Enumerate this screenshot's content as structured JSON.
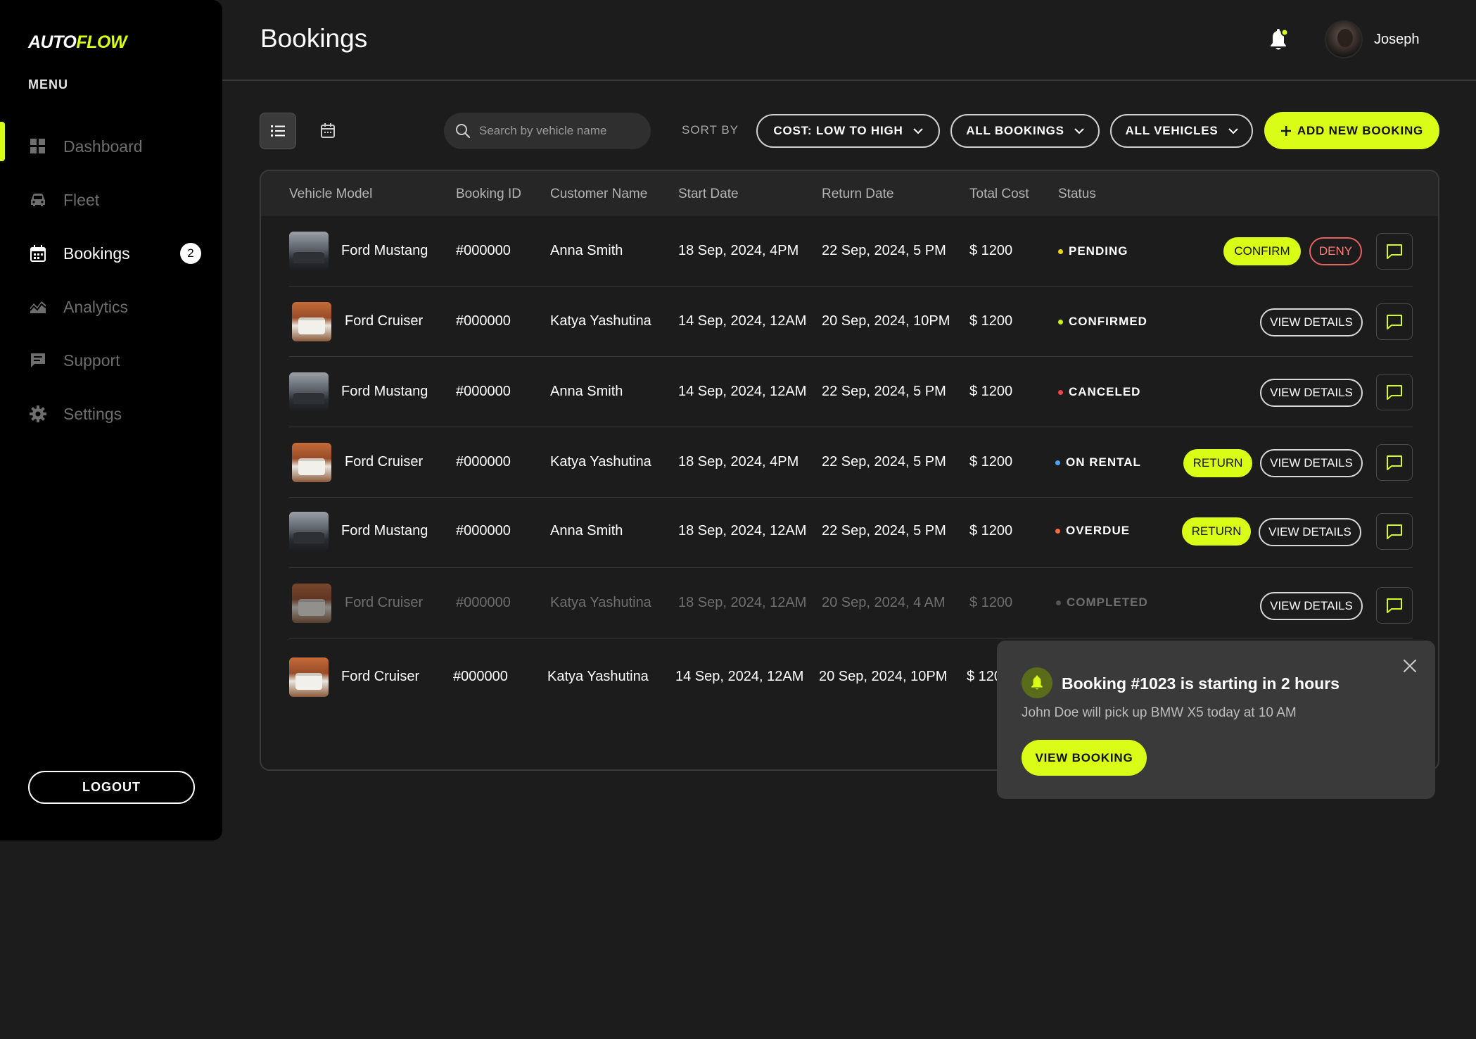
{
  "app": {
    "logo_part1": "AUTO",
    "logo_part2": "FLOW",
    "menu_label": "MENU",
    "accent_color": "#d9fd17"
  },
  "sidebar": {
    "items": [
      {
        "label": "Dashboard",
        "icon": "dashboard-icon",
        "active": false
      },
      {
        "label": "Fleet",
        "icon": "car-icon",
        "active": false
      },
      {
        "label": "Bookings",
        "icon": "calendar-icon",
        "active": true,
        "badge": "2"
      },
      {
        "label": "Analytics",
        "icon": "analytics-icon",
        "active": false
      },
      {
        "label": "Support",
        "icon": "chat-icon",
        "active": false
      },
      {
        "label": "Settings",
        "icon": "gear-icon",
        "active": false
      }
    ],
    "logout_label": "LOGOUT"
  },
  "header": {
    "title": "Bookings",
    "username": "Joseph",
    "bell_icon": "bell-icon"
  },
  "toolbar": {
    "search_placeholder": "Search by vehicle name",
    "sort_label": "SORT BY",
    "sort_value": "COST: LOW TO HIGH",
    "bookings_filter": "ALL BOOKINGS",
    "vehicles_filter": "ALL VEHICLES",
    "add_label": "ADD NEW BOOKING"
  },
  "table": {
    "columns": [
      "Vehicle Model",
      "Booking ID",
      "Customer Name",
      "Start Date",
      "Return Date",
      "Total Cost",
      "Status"
    ],
    "rows": [
      {
        "vehicle": "Ford Mustang",
        "thumb": "mustang",
        "id": "#000000",
        "customer": "Anna Smith",
        "start": "18 Sep, 2024, 4PM",
        "return": "22 Sep, 2024, 5 PM",
        "cost": "$ 1200",
        "status": "PENDING",
        "status_color": "#e8d61a"
      },
      {
        "vehicle": "Ford Cruiser",
        "thumb": "cruiser",
        "id": "#000000",
        "customer": "Katya Yashutina",
        "start": "14 Sep, 2024, 12AM",
        "return": "20 Sep, 2024, 10PM",
        "cost": "$ 1200",
        "status": "CONFIRMED",
        "status_color": "#c6f21a"
      },
      {
        "vehicle": "Ford Mustang",
        "thumb": "mustang",
        "id": "#000000",
        "customer": "Anna Smith",
        "start": "14 Sep, 2024, 12AM",
        "return": "22 Sep, 2024, 5 PM",
        "cost": "$ 1200",
        "status": "CANCELED",
        "status_color": "#f04545"
      },
      {
        "vehicle": "Ford Cruiser",
        "thumb": "cruiser",
        "id": "#000000",
        "customer": "Katya Yashutina",
        "start": "18 Sep, 2024, 4PM",
        "return": "22 Sep, 2024, 5 PM",
        "cost": "$ 1200",
        "status": "ON RENTAL",
        "status_color": "#4da3ff"
      },
      {
        "vehicle": "Ford Mustang",
        "thumb": "mustang",
        "id": "#000000",
        "customer": "Anna Smith",
        "start": "18 Sep, 2024, 12AM",
        "return": "22 Sep, 2024, 5 PM",
        "cost": "$ 1200",
        "status": "OVERDUE",
        "status_color": "#ff6a3d"
      },
      {
        "vehicle": "Ford Cruiser",
        "thumb": "cruiser",
        "id": "#000000",
        "customer": "Katya Yashutina",
        "start": "18 Sep, 2024, 12AM",
        "return": "20 Sep, 2024, 4 AM",
        "cost": "$ 1200",
        "status": "COMPLETED",
        "status_color": "#555555"
      },
      {
        "vehicle": "Ford Cruiser",
        "thumb": "cruiser",
        "id": "#000000",
        "customer": "Katya Yashutina",
        "start": "14 Sep, 2024, 12AM",
        "return": "20 Sep, 2024, 10PM",
        "cost": "$ 120"
      }
    ],
    "actions": {
      "confirm": "CONFIRM",
      "deny": "DENY",
      "view_details": "VIEW DETAILS",
      "return": "RETURN"
    }
  },
  "toast": {
    "title": "Booking #1023 is starting in 2 hours",
    "body": "John Doe will pick up BMW X5 today at 10 AM",
    "button": "VIEW BOOKING"
  }
}
